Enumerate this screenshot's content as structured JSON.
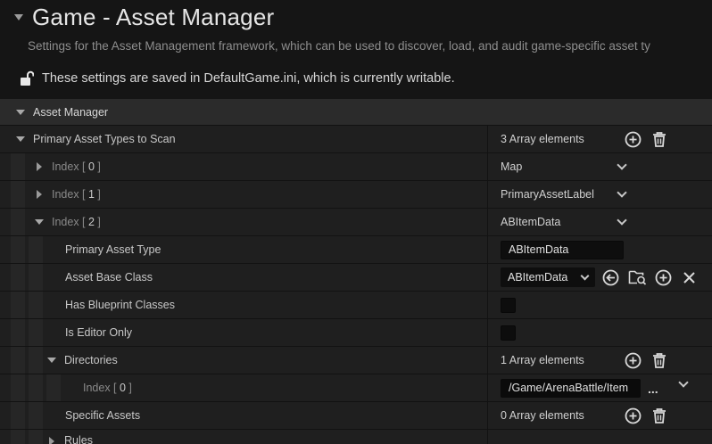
{
  "page": {
    "title": "Game - Asset Manager",
    "description": "Settings for the Asset Management framework, which can be used to discover, load, and audit game-specific asset ty",
    "writable_notice": "These settings are saved in DefaultGame.ini, which is currently writable."
  },
  "section": {
    "label": "Asset Manager"
  },
  "primary_asset_types": {
    "label": "Primary Asset Types to Scan",
    "count_label": "3 Array elements",
    "items": [
      {
        "index_label": "Index [ ",
        "index_value": "0",
        "index_end": " ]",
        "value": "Map"
      },
      {
        "index_label": "Index [ ",
        "index_value": "1",
        "index_end": " ]",
        "value": "PrimaryAssetLabel"
      },
      {
        "index_label": "Index [ ",
        "index_value": "2",
        "index_end": " ]",
        "value": "ABItemData"
      }
    ]
  },
  "item2": {
    "primary_asset_type_label": "Primary Asset Type",
    "primary_asset_type_value": "ABItemData",
    "asset_base_class_label": "Asset Base Class",
    "asset_base_class_value": "ABItemData",
    "has_blueprint_classes_label": "Has Blueprint Classes",
    "has_blueprint_classes_checked": false,
    "is_editor_only_label": "Is Editor Only",
    "is_editor_only_checked": false,
    "directories_label": "Directories",
    "directories_count": "1 Array elements",
    "dir_index_label": "Index [ ",
    "dir_index_value": "0",
    "dir_index_end": " ]",
    "dir_path": "/Game/ArenaBattle/Item",
    "dir_more": "...",
    "specific_assets_label": "Specific Assets",
    "specific_assets_count": "0 Array elements",
    "rules_label": "Rules"
  },
  "icons": {
    "lock": "unlock-icon",
    "add": "add-circle-icon",
    "delete": "trash-icon",
    "use_selected": "arrow-left-circle-icon",
    "browse": "folder-search-icon",
    "clear": "close-icon",
    "dropdown": "chevron-down-icon"
  }
}
